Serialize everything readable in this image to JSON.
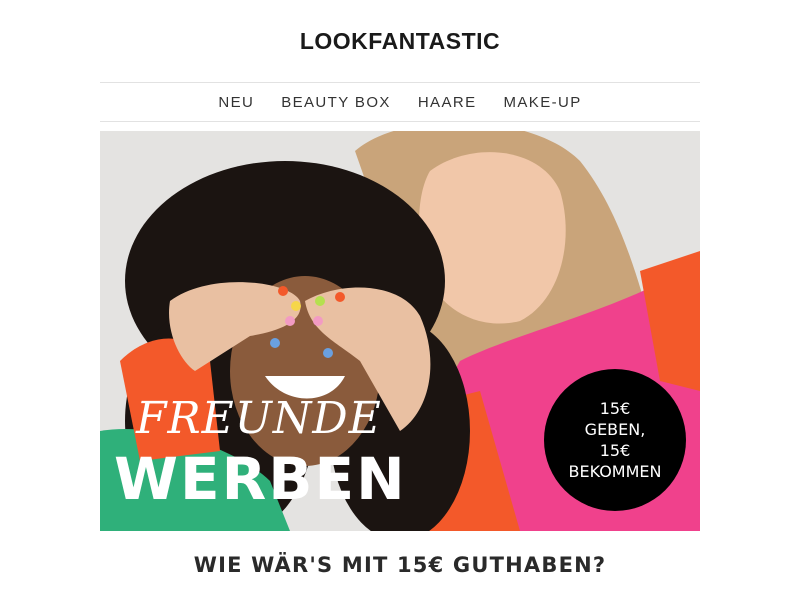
{
  "header": {
    "brand": "LOOKFANTASTIC"
  },
  "nav": {
    "items": [
      {
        "label": "NEU"
      },
      {
        "label": "BEAUTY BOX"
      },
      {
        "label": "HAARE"
      },
      {
        "label": "MAKE-UP"
      }
    ]
  },
  "hero": {
    "title_top": "FREUNDE",
    "title_bottom": "WERBEN",
    "badge": {
      "line1": "15€",
      "line2": "GEBEN,",
      "line3": "15€",
      "line4": "BEKOMMEN"
    }
  },
  "main": {
    "headline": "WIE WÄR'S MIT 15€ GUTHABEN?"
  },
  "colors": {
    "sweater_pink": "#f0418c",
    "sweater_orange": "#f3592a",
    "top_green": "#2fb07a",
    "badge_black": "#000000",
    "hero_background": "#e4e3e1"
  }
}
